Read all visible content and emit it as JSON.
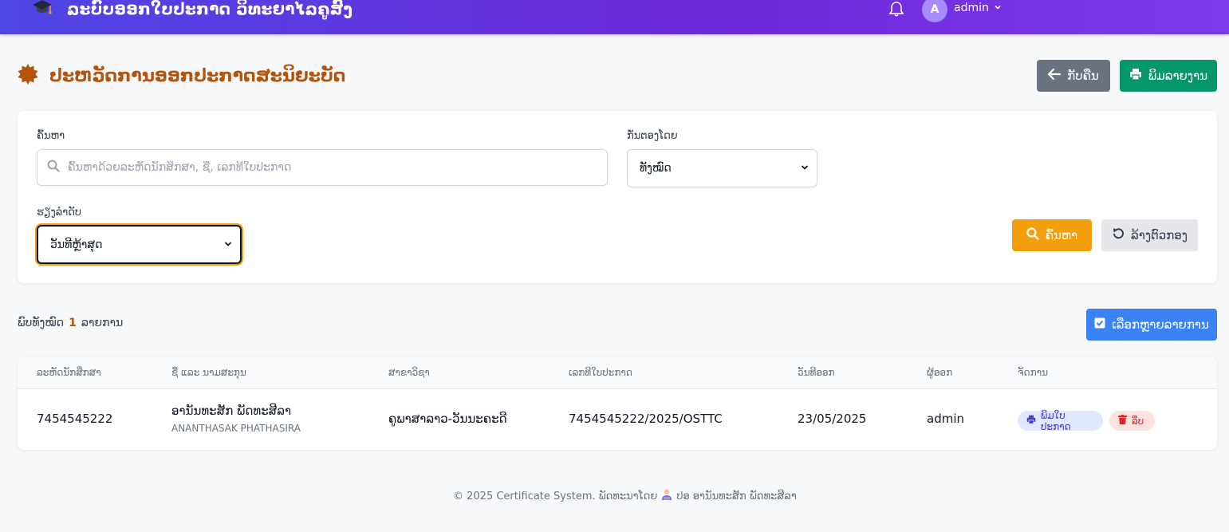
{
  "header": {
    "title": "ລະບົບອອກໃບປະກາດ ວິທະຍາໄລຄູສົງ",
    "user_initial": "A",
    "user_name": "admin"
  },
  "page": {
    "title": "ປະຫວັດການອອກປະກາດສະນິຍະບັດ",
    "back_label": "ກັບຄືນ",
    "print_report_label": "ພິມລາຍງານ"
  },
  "filters": {
    "search_label": "ຄົ້ນຫາ",
    "search_placeholder": "ຄົ້ນຫາດ້ວຍລະຫັດນັກສຶກສາ, ຊື່, ເລກທີໃບປະກາດ",
    "filter_label": "ກັ່ນຕອງໂດຍ",
    "filter_value": "ທັງໝົດ",
    "sort_label": "ຮຽງລຳດັບ",
    "sort_value": "ວັນທີຫຼ້າສຸດ",
    "search_button": "ຄົ້ນຫາ",
    "reset_button": "ລ້າງຕົວກອງ"
  },
  "summary": {
    "prefix": "ພົບທັງໝົດ",
    "count": "1",
    "suffix": "ລາຍການ",
    "multi_select_label": "ເລືອກຫຼາຍລາຍການ"
  },
  "table": {
    "columns": [
      "ລະຫັດນັກສຶກສາ",
      "ຊື່ ແລະ ນາມສະກຸນ",
      "ສາຂາວິຊາ",
      "ເລກທີໃບປະກາດ",
      "ວັນທີອອກ",
      "ຜູ້ອອກ",
      "ຈັດການ"
    ],
    "rows": [
      {
        "student_id": "7454545222",
        "name_lao": "ອານັນທະສັກ ພັດທະສີລາ",
        "name_en": "ANANTHASAK PHATHASIRA",
        "major": "ຄູພາສາລາວ-ວັນນະຄະດີ",
        "certificate_no": "7454545222/2025/OSTTC",
        "issue_date": "23/05/2025",
        "issuer": "admin",
        "print_action": "ພິມໃບປະກາດ",
        "delete_action": "ລຶບ"
      }
    ]
  },
  "footer": {
    "text": "© 2025 Certificate System. ພັດທະນາໂດຍ",
    "author": "ປອ ອານັນທະສັກ ພັດທະສີລາ"
  },
  "colors": {
    "header_start": "#4f46e5",
    "header_end": "#7c3aed",
    "title": "#b45309",
    "print_green": "#059669",
    "search_amber": "#f59e0b",
    "multi_blue": "#3b82f6"
  }
}
